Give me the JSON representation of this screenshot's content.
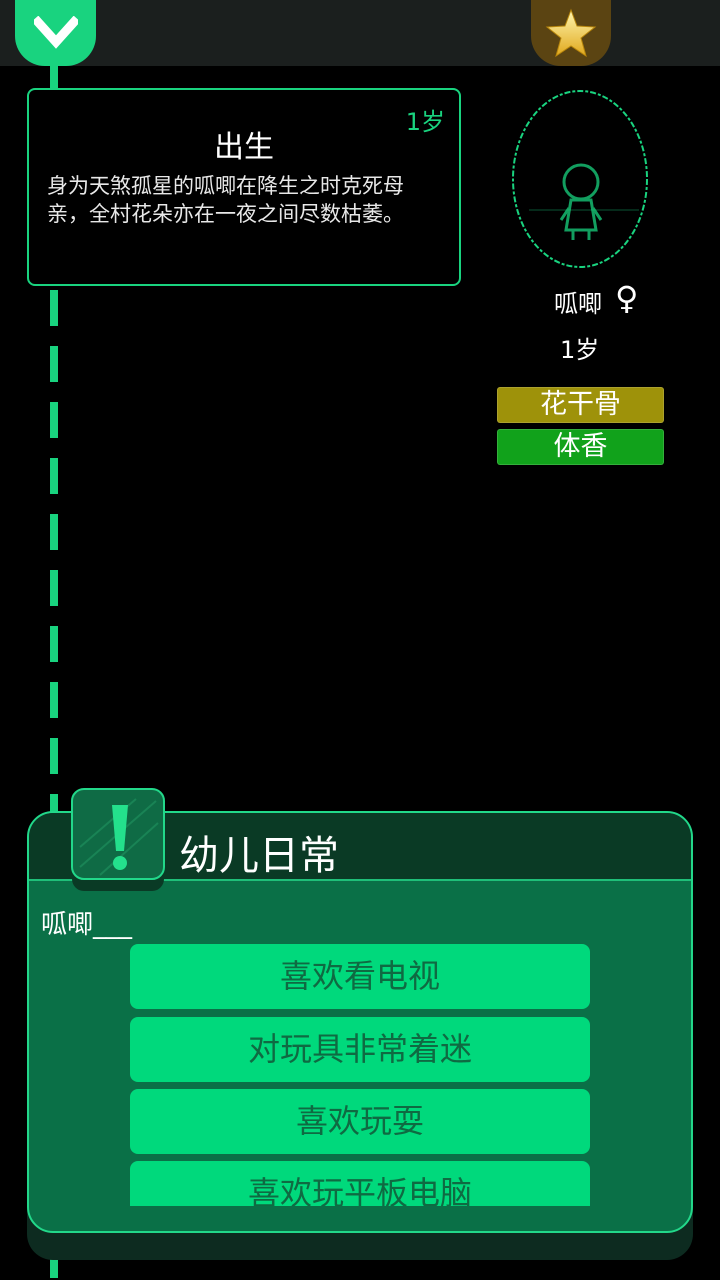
{
  "top_bar": {
    "collapse_icon": "chevron-down-icon",
    "achievement_icon": "star-icon"
  },
  "event": {
    "age": "1岁",
    "title": "出生",
    "text": "身为天煞孤星的呱唧在降生之时克死母亲，全村花朵亦在一夜之间尽数枯萎。"
  },
  "character": {
    "name": "呱唧",
    "gender_icon": "female-icon",
    "gender_symbol": "♀",
    "age": "1岁",
    "tags": [
      "花干骨",
      "体香"
    ]
  },
  "choice_panel": {
    "title": "幼儿日常",
    "prompt": "呱唧___",
    "options": [
      "喜欢看电视",
      "对玩具非常着迷",
      "喜欢玩耍",
      "喜欢玩平板电脑"
    ]
  },
  "colors": {
    "accent": "#19d37f",
    "panel": "#0a7047",
    "option": "#00d97c",
    "option_text": "#0f6a42",
    "tag_gold": "#9e920a",
    "tag_green": "#11a21b"
  }
}
